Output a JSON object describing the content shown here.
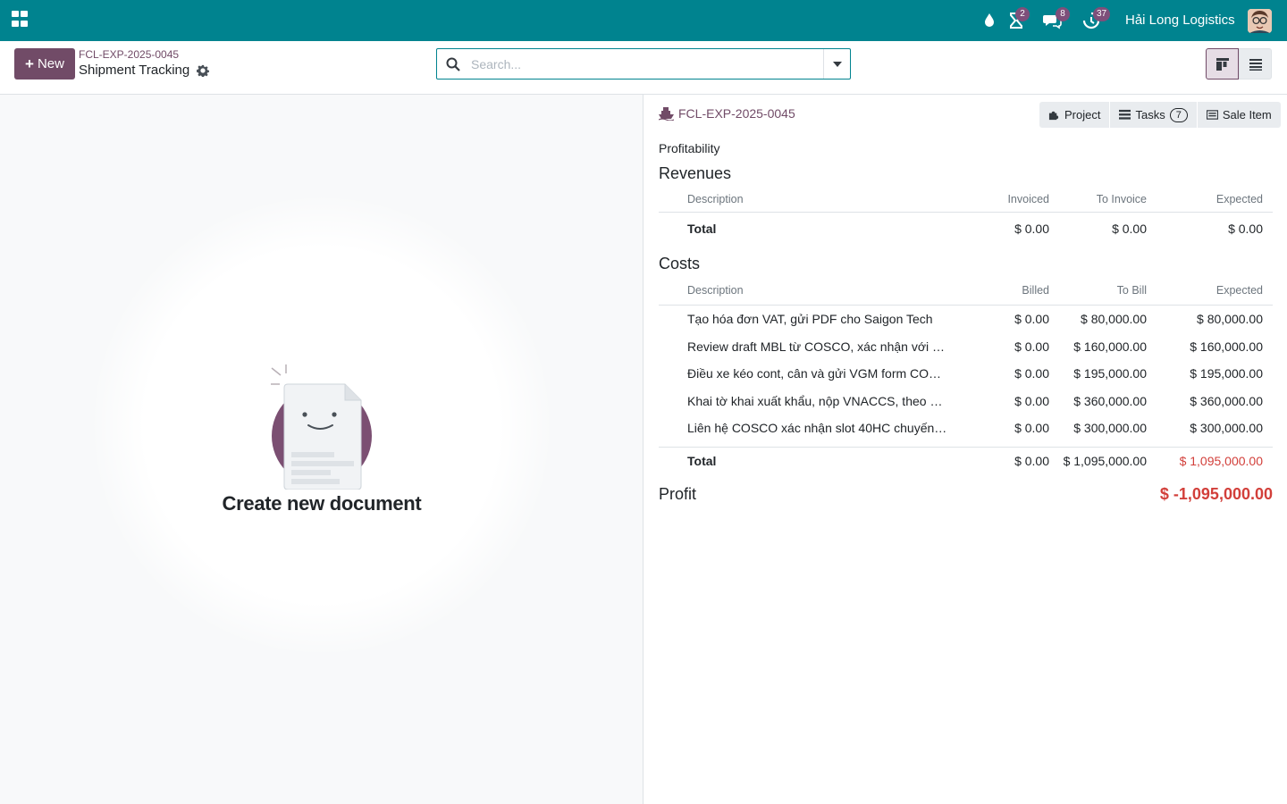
{
  "navbar": {
    "badges": {
      "activity": "2",
      "messages": "8",
      "timer": "37"
    },
    "company": "Hải Long Logistics"
  },
  "control": {
    "new_label": "New",
    "breadcrumb": "FCL-EXP-2025-0045",
    "title": "Shipment Tracking",
    "search_placeholder": "Search..."
  },
  "empty": {
    "title": "Create new document"
  },
  "panel": {
    "project_name": "FCL-EXP-2025-0045",
    "buttons": {
      "project": "Project",
      "tasks": "Tasks",
      "tasks_count": "7",
      "sale_item": "Sale Item"
    },
    "profitability_label": "Profitability",
    "revenues": {
      "title": "Revenues",
      "headers": [
        "Description",
        "Invoiced",
        "To Invoice",
        "Expected"
      ],
      "total": {
        "label": "Total",
        "v1": "$ 0.00",
        "v2": "$ 0.00",
        "v3": "$ 0.00"
      }
    },
    "costs": {
      "title": "Costs",
      "headers": [
        "Description",
        "Billed",
        "To Bill",
        "Expected"
      ],
      "rows": [
        {
          "desc": "Tạo hóa đơn VAT, gửi PDF cho Saigon Tech",
          "v1": "$ 0.00",
          "v2": "$ 80,000.00",
          "v3": "$ 80,000.00"
        },
        {
          "desc": "Review draft MBL từ COSCO, xác nhận với …",
          "v1": "$ 0.00",
          "v2": "$ 160,000.00",
          "v3": "$ 160,000.00"
        },
        {
          "desc": "Điều xe kéo cont, cân và gửi VGM form CO…",
          "v1": "$ 0.00",
          "v2": "$ 195,000.00",
          "v3": "$ 195,000.00"
        },
        {
          "desc": "Khai tờ khai xuất khẩu, nộp VNACCS, theo …",
          "v1": "$ 0.00",
          "v2": "$ 360,000.00",
          "v3": "$ 360,000.00"
        },
        {
          "desc": "Liên hệ COSCO xác nhận slot 40HC chuyến…",
          "v1": "$ 0.00",
          "v2": "$ 300,000.00",
          "v3": "$ 300,000.00"
        }
      ],
      "total": {
        "label": "Total",
        "v1": "$ 0.00",
        "v2": "$ 1,095,000.00",
        "v3": "$ 1,095,000.00"
      }
    },
    "profit": {
      "label": "Profit",
      "value": "$ -1,095,000.00"
    }
  },
  "colors": {
    "brand": "#714b67",
    "navbar": "#00838f",
    "danger": "#d23f3a"
  }
}
